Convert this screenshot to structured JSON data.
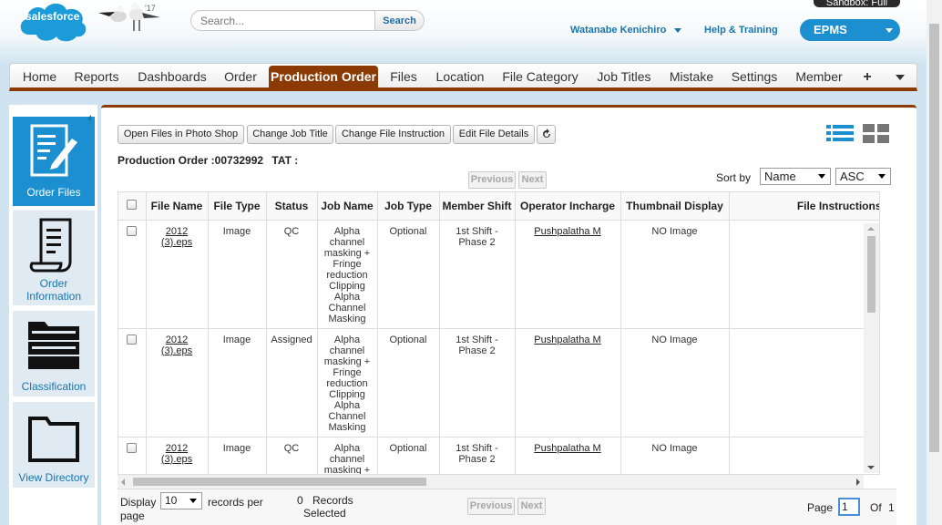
{
  "header": {
    "logo_text": "salesforce",
    "mascot_year": "'17",
    "search_placeholder": "Search...",
    "search_button": "Search",
    "user_name": "Watanabe Kenichiro",
    "help_link": "Help & Training",
    "sandbox_label": "Sandbox: Full",
    "app_name": "EPMS"
  },
  "tabs": [
    {
      "label": "Home"
    },
    {
      "label": "Reports"
    },
    {
      "label": "Dashboards"
    },
    {
      "label": "Order"
    },
    {
      "label": "Production Order",
      "active": true
    },
    {
      "label": "Files"
    },
    {
      "label": "Location"
    },
    {
      "label": "File Category"
    },
    {
      "label": "Job Titles"
    },
    {
      "label": "Mistake"
    },
    {
      "label": "Settings"
    },
    {
      "label": "Member"
    },
    {
      "label": "+"
    }
  ],
  "sidebar": {
    "items": [
      {
        "label": "Order Files",
        "icon": "document-edit-icon",
        "active": true
      },
      {
        "label": "Order Information",
        "icon": "receipt-icon"
      },
      {
        "label": "Classification",
        "icon": "folders-icon"
      },
      {
        "label": "View Directory",
        "icon": "folder-icon"
      }
    ]
  },
  "toolbar": {
    "open_photoshop": "Open Files in Photo Shop",
    "change_job_title": "Change Job Title",
    "change_file_instruction": "Change File Instruction",
    "edit_file_details": "Edit File Details",
    "refresh_icon": "refresh-icon"
  },
  "order": {
    "label": "Production Order :00732992",
    "tat": "TAT :"
  },
  "pager": {
    "previous": "Previous",
    "next": "Next"
  },
  "sort": {
    "label": "Sort  by",
    "field": "Name",
    "direction": "ASC"
  },
  "table": {
    "columns": [
      "File Name",
      "File Type",
      "Status",
      "Job Name",
      "Job Type",
      "Member Shift",
      "Operator Incharge",
      "Thumbnail Display",
      "File Instructions"
    ],
    "rows": [
      {
        "file_name": "2012 (3).eps",
        "file_type": "Image",
        "status": "QC",
        "job_name": "Alpha channel masking + Fringe reduction Clipping Alpha Channel Masking",
        "job_type": "Optional",
        "member_shift": "1st Shift - Phase 2",
        "operator": "Pushpalatha M",
        "thumbnail": "NO Image",
        "instructions": ""
      },
      {
        "file_name": "2012 (3).eps",
        "file_type": "Image",
        "status": "Assigned",
        "job_name": "Alpha channel masking + Fringe reduction Clipping Alpha Channel Masking",
        "job_type": "Optional",
        "member_shift": "1st Shift - Phase 2",
        "operator": "Pushpalatha M",
        "thumbnail": "NO Image",
        "instructions": ""
      },
      {
        "file_name": "2012 (3).eps",
        "file_type": "Image",
        "status": "QC",
        "job_name": "Alpha channel masking + Fringe reduction Clipping Alpha Channel Masking",
        "job_type": "Optional",
        "member_shift": "1st Shift - Phase 2",
        "operator": "Pushpalatha M",
        "thumbnail": "NO Image",
        "instructions": ""
      }
    ]
  },
  "footer": {
    "display_label": "Display",
    "page_size": "10",
    "records_per_page": "records per page",
    "records_selected_count": "0",
    "records_selected_label": "Records Selected",
    "page_label": "Page",
    "page_value": "1",
    "of_label": "Of",
    "total_pages": "1"
  },
  "colors": {
    "accent_tab": "#8a3a02",
    "brand_blue": "#1b8fd0",
    "link_blue": "#1b75ad"
  }
}
